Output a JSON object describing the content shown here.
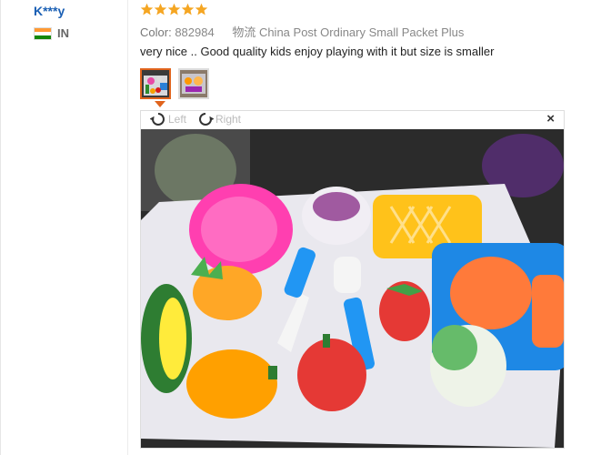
{
  "reviewer": {
    "name": "K***y",
    "country_code": "IN"
  },
  "rating": {
    "stars": 5,
    "max": 5,
    "color": "#f5a623"
  },
  "meta": {
    "color_label": "Color:",
    "color_value": "882984",
    "shipping": "物流 China Post Ordinary Small Packet Plus"
  },
  "review": {
    "text": "very nice .. Good quality kids enjoy playing with it but size is smaller"
  },
  "thumbnails": [
    {
      "name": "photo-1",
      "selected": true
    },
    {
      "name": "photo-2",
      "selected": false
    }
  ],
  "viewer": {
    "rotate_left_label": "Left",
    "rotate_right_label": "Right",
    "close_label": "×"
  },
  "colors": {
    "username": "#1a5fb4",
    "accent": "#e0641d"
  }
}
